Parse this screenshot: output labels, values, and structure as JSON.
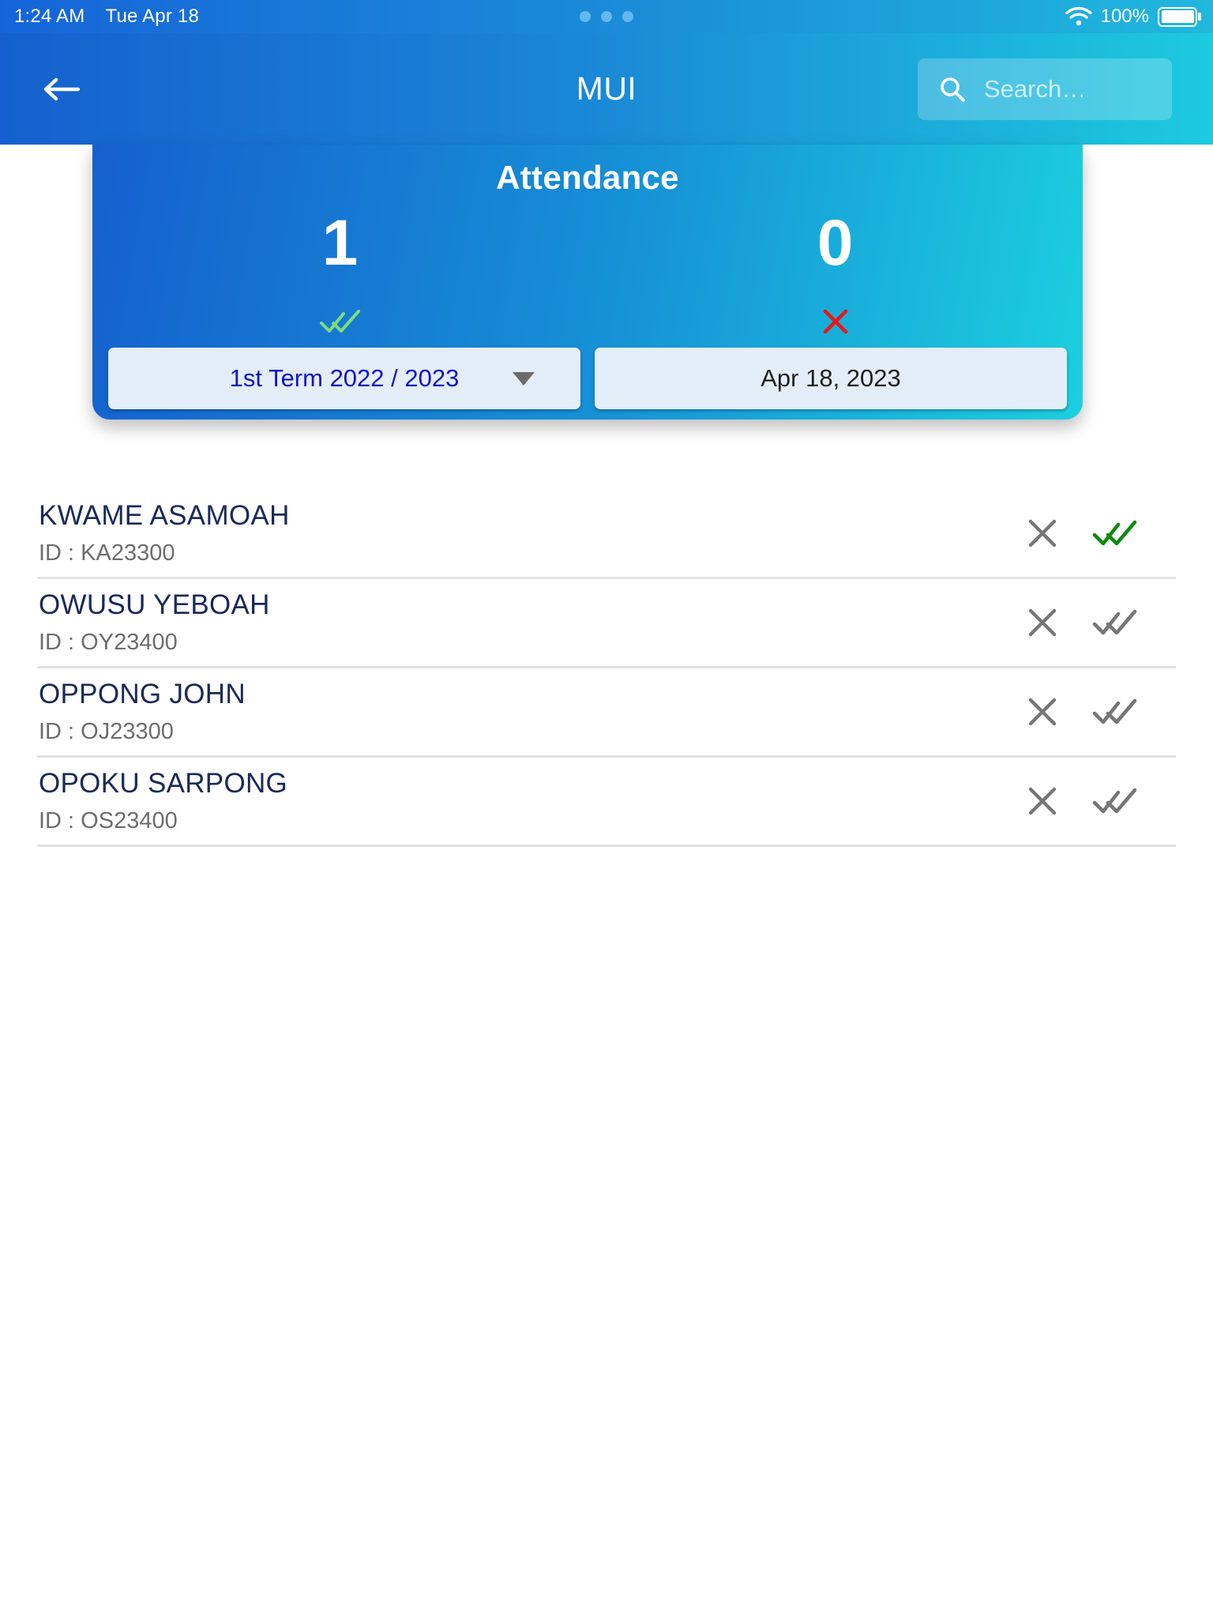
{
  "status_bar": {
    "time": "1:24 AM",
    "date": "Tue Apr 18",
    "battery_percent": "100%",
    "wifi_icon": "wifi-icon",
    "battery_icon": "battery-full-icon",
    "dots_indicator": "three-dots-icon"
  },
  "app_bar": {
    "back_icon": "arrow-left-icon",
    "title": "MUI",
    "search_icon": "search-icon",
    "search_value": "",
    "search_placeholder": "Search…"
  },
  "attendance_card": {
    "title": "Attendance",
    "present": {
      "count": "1",
      "icon": "double-check-icon",
      "icon_color": "#7ddd7d"
    },
    "absent": {
      "count": "0",
      "icon": "close-x-icon",
      "icon_color": "#e81818"
    },
    "term_selector": {
      "value": "1st Term 2022 / 2023",
      "arrow_icon": "chevron-down-icon"
    },
    "date_selector": {
      "value": "Apr 18, 2023"
    },
    "colors": {
      "gradient_start": "#1560ce",
      "gradient_end": "#1ccfdf",
      "selector_bg": "#e3eef8",
      "term_text": "#1313c8"
    }
  },
  "student_list": {
    "id_prefix": "ID : ",
    "students": [
      {
        "name": "KWAME ASAMOAH",
        "id_label": "ID : KA23300",
        "absent_icon": "close-x-icon",
        "present_icon": "double-check-icon",
        "present_state": "active",
        "present_color": "#0f8a12"
      },
      {
        "name": "OWUSU YEBOAH",
        "id_label": "ID : OY23400",
        "absent_icon": "close-x-icon",
        "present_icon": "double-check-icon",
        "present_state": "inactive",
        "present_color": "#767676"
      },
      {
        "name": "OPPONG JOHN",
        "id_label": "ID : OJ23300",
        "absent_icon": "close-x-icon",
        "present_icon": "double-check-icon",
        "present_state": "inactive",
        "present_color": "#767676"
      },
      {
        "name": "OPOKU SARPONG",
        "id_label": "ID : OS23400",
        "absent_icon": "close-x-icon",
        "present_icon": "double-check-icon",
        "present_state": "inactive",
        "present_color": "#767676"
      }
    ]
  }
}
